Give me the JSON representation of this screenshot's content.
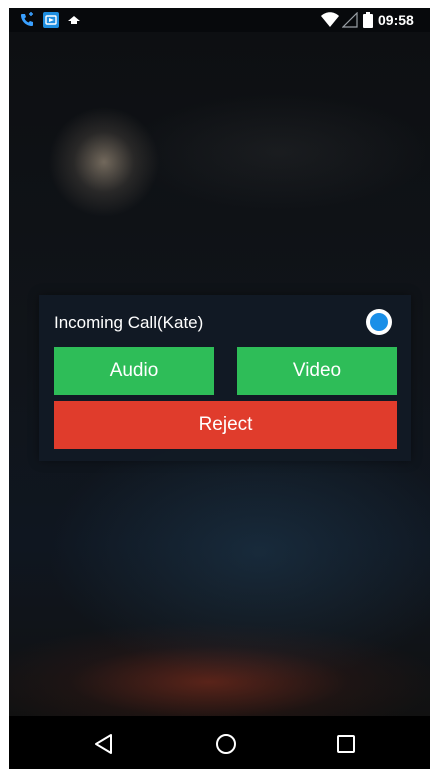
{
  "status_bar": {
    "time": "09:58",
    "icons": [
      "phone-notification-icon",
      "app-notification-icon",
      "notification-icon",
      "wifi-icon",
      "signal-icon",
      "battery-icon"
    ]
  },
  "incoming_call": {
    "title": "Incoming Call(Kate)",
    "audio_label": "Audio",
    "video_label": "Video",
    "reject_label": "Reject"
  },
  "colors": {
    "accept": "#2ebd58",
    "reject": "#e03c2c",
    "status_dot": "#1a8fe8"
  },
  "nav_bar": {
    "icons": [
      "back-icon",
      "home-icon",
      "recents-icon"
    ]
  }
}
